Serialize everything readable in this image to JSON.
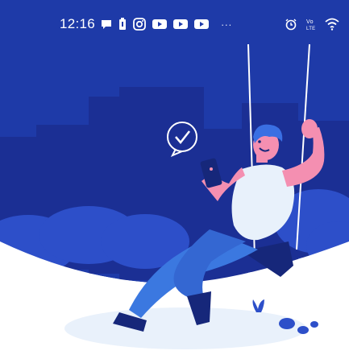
{
  "status_bar": {
    "time": "12:16",
    "more": "···",
    "left_icons": [
      "chat-bubble-icon",
      "battery-icon",
      "instagram-icon",
      "youtube-icon",
      "youtube-icon",
      "youtube-icon"
    ],
    "right_icons": [
      "alarm-icon",
      "volte-icon",
      "wifi-icon"
    ],
    "volte_label": "Vo LTE"
  },
  "illustration": {
    "subject": "person on swing holding phone with check-mark speech bubble",
    "colors": {
      "night_sky": "#1e3aa8",
      "buildings": "#1b2f94",
      "bushes": "#2d4fc9",
      "skin": "#f48fb1",
      "shirt": "#e8f1fb",
      "pants": "#3b78e0",
      "hair": "#3a6fe3",
      "seat": "#16277a",
      "ground_shadow": "#e9f1fb"
    }
  }
}
